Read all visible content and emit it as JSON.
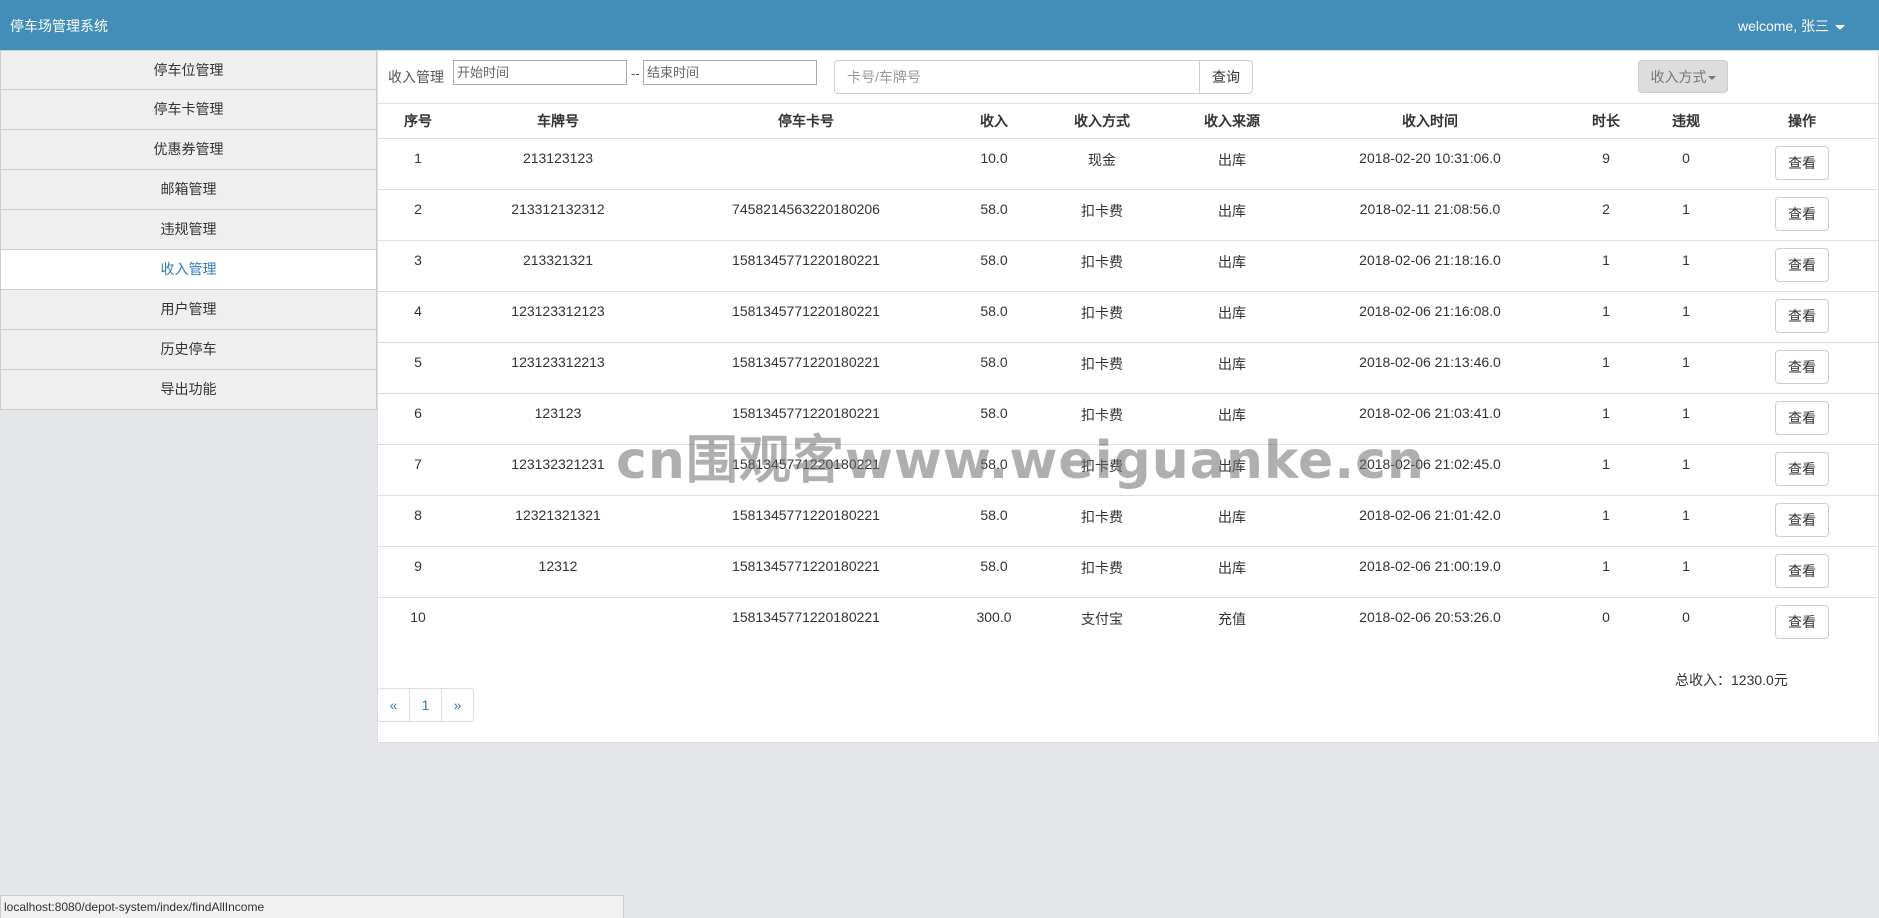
{
  "navbar": {
    "brand": "停车场管理系统",
    "user": "welcome, 张三"
  },
  "sidebar": {
    "items": [
      {
        "label": "停车位管理",
        "active": false
      },
      {
        "label": "停车卡管理",
        "active": false
      },
      {
        "label": "优惠券管理",
        "active": false
      },
      {
        "label": "邮箱管理",
        "active": false
      },
      {
        "label": "违规管理",
        "active": false
      },
      {
        "label": "收入管理",
        "active": true
      },
      {
        "label": "用户管理",
        "active": false
      },
      {
        "label": "历史停车",
        "active": false
      },
      {
        "label": "导出功能",
        "active": false
      }
    ]
  },
  "toolbar": {
    "label": "收入管理",
    "start_placeholder": "开始时间",
    "date_separator": "--",
    "end_placeholder": "结束时间",
    "search_placeholder": "卡号/车牌号",
    "search_label": "查询",
    "filter_label": "收入方式"
  },
  "table": {
    "headers": [
      "序号",
      "车牌号",
      "停车卡号",
      "收入",
      "收入方式",
      "收入来源",
      "收入时间",
      "时长",
      "违规",
      "操作"
    ],
    "action_label": "查看",
    "rows": [
      [
        "1",
        "213123123",
        "",
        "10.0",
        "现金",
        "出库",
        "2018-02-20 10:31:06.0",
        "9",
        "0"
      ],
      [
        "2",
        "213312132312",
        "7458214563220180206",
        "58.0",
        "扣卡费",
        "出库",
        "2018-02-11 21:08:56.0",
        "2",
        "1"
      ],
      [
        "3",
        "213321321",
        "1581345771220180221",
        "58.0",
        "扣卡费",
        "出库",
        "2018-02-06 21:18:16.0",
        "1",
        "1"
      ],
      [
        "4",
        "123123312123",
        "1581345771220180221",
        "58.0",
        "扣卡费",
        "出库",
        "2018-02-06 21:16:08.0",
        "1",
        "1"
      ],
      [
        "5",
        "123123312213",
        "1581345771220180221",
        "58.0",
        "扣卡费",
        "出库",
        "2018-02-06 21:13:46.0",
        "1",
        "1"
      ],
      [
        "6",
        "123123",
        "1581345771220180221",
        "58.0",
        "扣卡费",
        "出库",
        "2018-02-06 21:03:41.0",
        "1",
        "1"
      ],
      [
        "7",
        "123132321231",
        "1581345771220180221",
        "58.0",
        "扣卡费",
        "出库",
        "2018-02-06 21:02:45.0",
        "1",
        "1"
      ],
      [
        "8",
        "12321321321",
        "1581345771220180221",
        "58.0",
        "扣卡费",
        "出库",
        "2018-02-06 21:01:42.0",
        "1",
        "1"
      ],
      [
        "9",
        "12312",
        "1581345771220180221",
        "58.0",
        "扣卡费",
        "出库",
        "2018-02-06 21:00:19.0",
        "1",
        "1"
      ],
      [
        "10",
        "",
        "1581345771220180221",
        "300.0",
        "支付宝",
        "充值",
        "2018-02-06 20:53:26.0",
        "0",
        "0"
      ]
    ]
  },
  "total": "总收入：1230.0元",
  "pagination": {
    "prev": "«",
    "current": "1",
    "next": "»"
  },
  "watermark": "cn围观客www.weiguanke.cn",
  "statusbar": "localhost:8080/depot-system/index/findAllIncome",
  "colors": {
    "navbar": "#438eb9",
    "active_link": "#337ab7",
    "background": "#e5e6ea"
  }
}
